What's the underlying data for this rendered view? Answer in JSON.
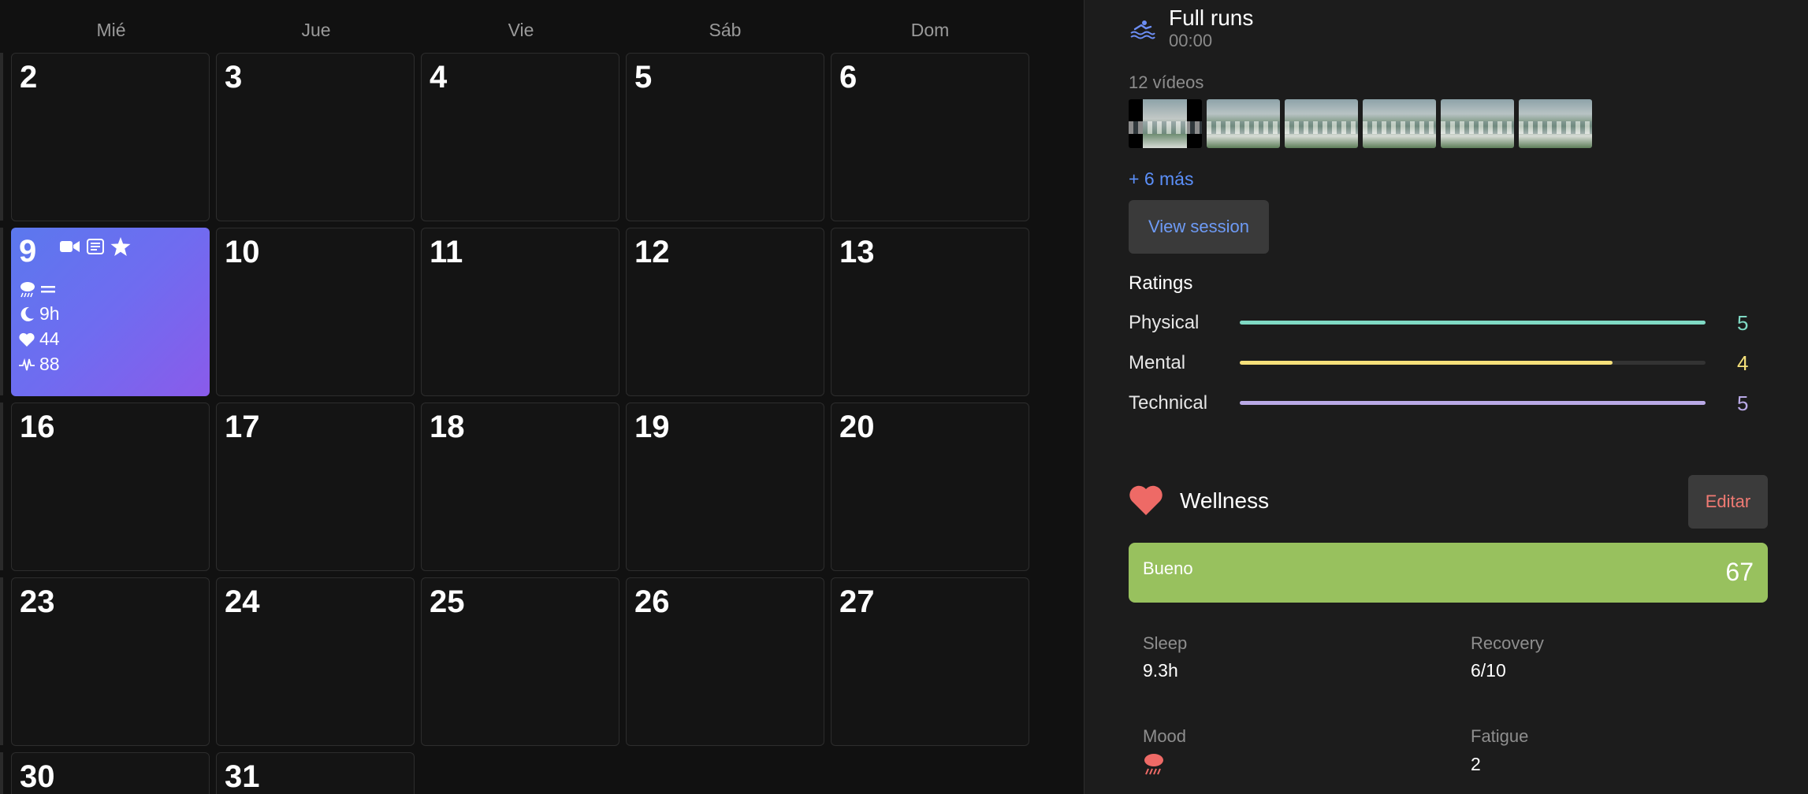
{
  "calendar": {
    "weekdays": [
      "Mié",
      "Jue",
      "Vie",
      "Sáb",
      "Dom"
    ],
    "weeks": [
      [
        "2",
        "3",
        "4",
        "5",
        "6"
      ],
      [
        "9",
        "10",
        "11",
        "12",
        "13"
      ],
      [
        "16",
        "17",
        "18",
        "19",
        "20"
      ],
      [
        "23",
        "24",
        "25",
        "26",
        "27"
      ],
      [
        "30",
        "31"
      ]
    ],
    "active_day": {
      "day": "9",
      "icons": [
        "video-icon",
        "note-icon",
        "star-icon"
      ],
      "weather_icon": "rain-cloud-icon",
      "mood_icon": "equals-icon",
      "sleep_icon": "moon-icon",
      "sleep": "9h",
      "heart_icon": "heart-icon",
      "heart_rate": "44",
      "pulse_icon": "pulse-icon",
      "hrv": "88",
      "colors": [
        "#5b78ee",
        "#8a5bea"
      ]
    }
  },
  "session": {
    "icon": "swimmer-icon",
    "title": "Full runs",
    "time": "00:00",
    "videos_label": "12 vídeos",
    "more_link": "+ 6 más",
    "view_button": "View session"
  },
  "ratings": {
    "title": "Ratings",
    "items": [
      {
        "label": "Physical",
        "value": "5",
        "fraction": 1.0,
        "color": "#7fd9c4"
      },
      {
        "label": "Mental",
        "value": "4",
        "fraction": 0.8,
        "color": "#f5e07a"
      },
      {
        "label": "Technical",
        "value": "5",
        "fraction": 1.0,
        "color": "#b9a9e6"
      }
    ]
  },
  "wellness": {
    "title": "Wellness",
    "edit_button": "Editar",
    "score_label": "Bueno",
    "score_value": "67",
    "score_color": "#98c15e",
    "metrics": {
      "sleep_label": "Sleep",
      "sleep_value": "9.3h",
      "recovery_label": "Recovery",
      "recovery_value": "6/10",
      "mood_label": "Mood",
      "mood_icon": "rain-cloud-icon",
      "fatigue_label": "Fatigue",
      "fatigue_value": "2"
    }
  }
}
